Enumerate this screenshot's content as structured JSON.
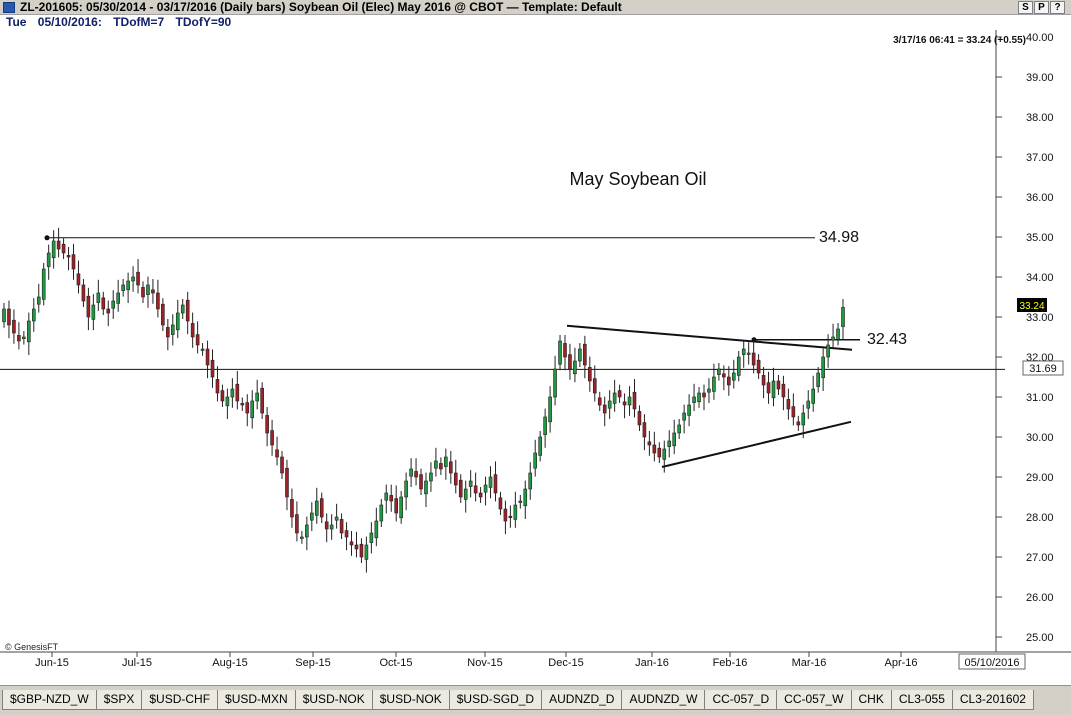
{
  "window": {
    "title": "ZL-201605:  05/30/2014 - 03/17/2016  (Daily bars)   Soybean Oil (Elec) May 2016 @ CBOT  —  Template: Default",
    "buttons": [
      "S",
      "P",
      "?"
    ]
  },
  "info": {
    "day": "Tue",
    "date": "05/10/2016:",
    "tdm": "TDofM=7",
    "tdy": "TDofY=90"
  },
  "quote": "3/17/16 06:41 = 33.24 (+0.55)",
  "copyright": "© GenesisFT",
  "cursor_date": "05/10/2016",
  "tabs": [
    "$GBP-NZD_W",
    "$SPX",
    "$USD-CHF",
    "$USD-MXN",
    "$USD-NOK",
    "$USD-NOK",
    "$USD-SGD_D",
    "AUDNZD_D",
    "AUDNZD_W",
    "CC-057_D",
    "CC-057_W",
    "CHK",
    "CL3-055",
    "CL3-201602"
  ],
  "colors": {
    "up": "#1f9a3e",
    "down": "#a02028",
    "frame": "#d4d0c8",
    "price_box": "#ffff00"
  },
  "chart_data": {
    "type": "candlestick",
    "title": "May Soybean Oil",
    "x_tick_labels": [
      "Jun-15",
      "Jul-15",
      "Aug-15",
      "Sep-15",
      "Oct-15",
      "Nov-15",
      "Dec-15",
      "Jan-16",
      "Feb-16",
      "Mar-16",
      "Apr-16"
    ],
    "y_tick_labels": [
      "25.00",
      "26.00",
      "27.00",
      "28.00",
      "29.00",
      "30.00",
      "31.00",
      "32.00",
      "33.00",
      "34.00",
      "35.00",
      "36.00",
      "37.00",
      "38.00",
      "39.00",
      "40.00"
    ],
    "ylim": [
      24.6,
      40.1
    ],
    "last_price": "33.24",
    "cursor_price": "31.69",
    "grid": false,
    "annotations": [
      {
        "label": "34.98",
        "value": 34.98
      },
      {
        "label": "32.43",
        "value": 32.43
      }
    ],
    "horizontal_line": 31.69,
    "closes": [
      33.2,
      32.8,
      32.6,
      32.4,
      32.5,
      32.9,
      33.2,
      33.5,
      34.2,
      34.6,
      34.9,
      34.7,
      34.6,
      34.5,
      34.2,
      33.8,
      33.4,
      33.0,
      33.3,
      33.6,
      33.2,
      33.1,
      33.4,
      33.6,
      33.8,
      33.9,
      34.0,
      33.8,
      33.5,
      33.8,
      33.6,
      33.2,
      32.8,
      32.5,
      32.8,
      33.1,
      33.3,
      32.9,
      32.5,
      32.3,
      32.2,
      31.8,
      31.5,
      31.1,
      30.9,
      31.0,
      31.2,
      30.9,
      30.8,
      30.6,
      30.9,
      31.1,
      30.6,
      30.1,
      29.8,
      29.5,
      29.1,
      28.5,
      28.0,
      27.6,
      27.5,
      27.8,
      28.1,
      28.4,
      28.0,
      27.7,
      27.8,
      28.0,
      27.6,
      27.5,
      27.3,
      27.2,
      27.0,
      27.3,
      27.6,
      27.9,
      28.3,
      28.6,
      28.4,
      28.1,
      28.5,
      28.9,
      29.2,
      29.0,
      28.7,
      28.9,
      29.1,
      29.4,
      29.2,
      29.5,
      29.1,
      28.8,
      28.5,
      28.7,
      28.9,
      28.6,
      28.5,
      28.8,
      29.0,
      28.6,
      28.2,
      27.9,
      28.0,
      28.3,
      28.4,
      28.7,
      29.1,
      29.6,
      30.0,
      30.5,
      31.0,
      31.7,
      32.4,
      32.0,
      31.7,
      31.9,
      32.2,
      31.8,
      31.4,
      31.1,
      30.8,
      30.6,
      30.9,
      31.1,
      31.0,
      30.8,
      31.0,
      30.7,
      30.3,
      30.0,
      29.8,
      29.6,
      29.5,
      29.7,
      29.9,
      30.1,
      30.3,
      30.6,
      30.8,
      31.0,
      31.1,
      31.0,
      31.2,
      31.5,
      31.7,
      31.5,
      31.3,
      31.6,
      32.0,
      32.2,
      32.1,
      31.8,
      31.6,
      31.3,
      31.1,
      31.4,
      31.2,
      31.0,
      30.7,
      30.5,
      30.3,
      30.6,
      30.9,
      31.2,
      31.6,
      32.0,
      32.3,
      32.5,
      32.7,
      33.24
    ]
  }
}
